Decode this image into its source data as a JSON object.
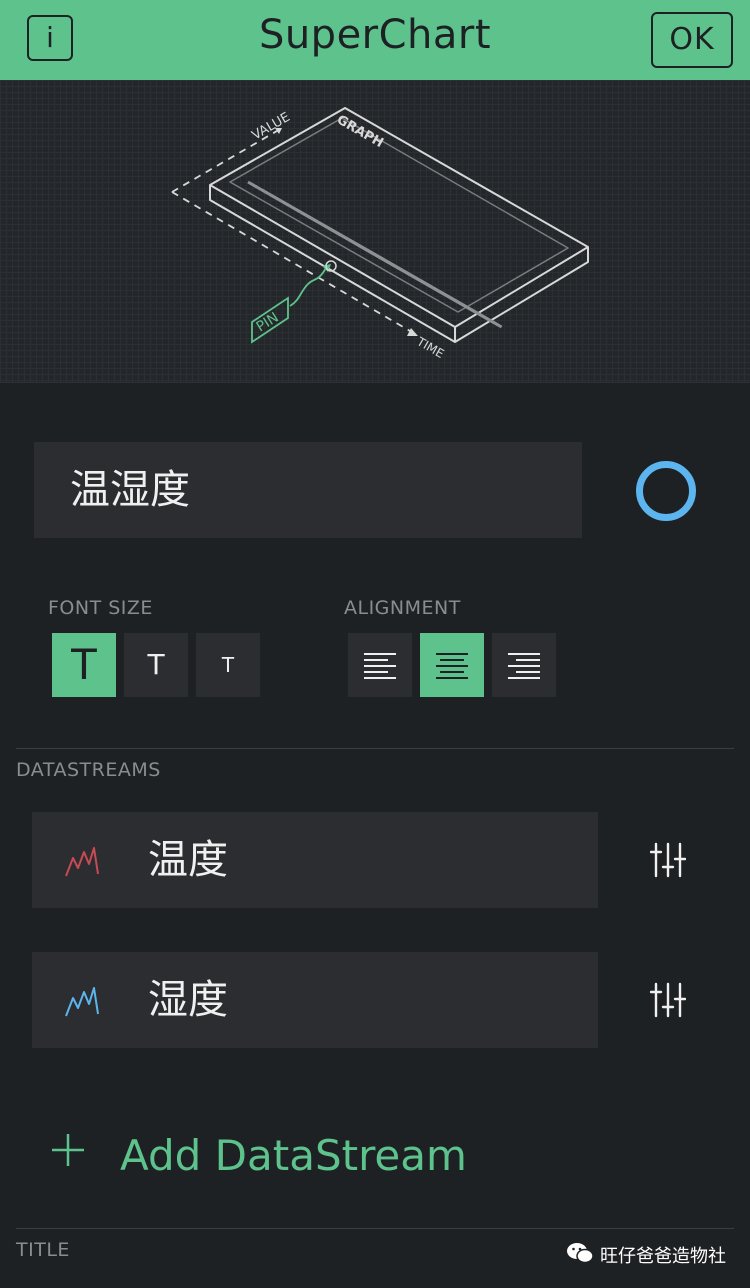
{
  "header": {
    "title": "SuperChart",
    "info_label": "i",
    "ok_label": "OK",
    "background": "#5ec28d"
  },
  "illustration": {
    "value_label": "VALUE",
    "graph_label": "GRAPH",
    "pin_label": "PIN",
    "time_label": "TIME"
  },
  "name_field": {
    "value": "温湿度"
  },
  "color_picker": {
    "color": "#5cb5ee"
  },
  "font_size": {
    "label": "FONT SIZE",
    "options": [
      {
        "glyph": "T",
        "selected": true
      },
      {
        "glyph": "T",
        "selected": false
      },
      {
        "glyph": "T",
        "selected": false
      }
    ]
  },
  "alignment": {
    "label": "ALIGNMENT",
    "options": [
      {
        "icon": "align-left-icon",
        "selected": false
      },
      {
        "icon": "align-center-icon",
        "selected": true
      },
      {
        "icon": "align-right-icon",
        "selected": false
      }
    ]
  },
  "datastreams": {
    "label": "DATASTREAMS",
    "items": [
      {
        "label": "温度",
        "color": "#c84a55",
        "icon": "line-chart-icon"
      },
      {
        "label": "湿度",
        "color": "#5cb5ee",
        "icon": "line-chart-icon"
      }
    ],
    "add_label": "Add DataStream",
    "add_icon": "plus-icon"
  },
  "title_section": {
    "label": "TITLE"
  },
  "watermark": {
    "text": "旺仔爸爸造物社",
    "icon": "wechat-icon"
  }
}
